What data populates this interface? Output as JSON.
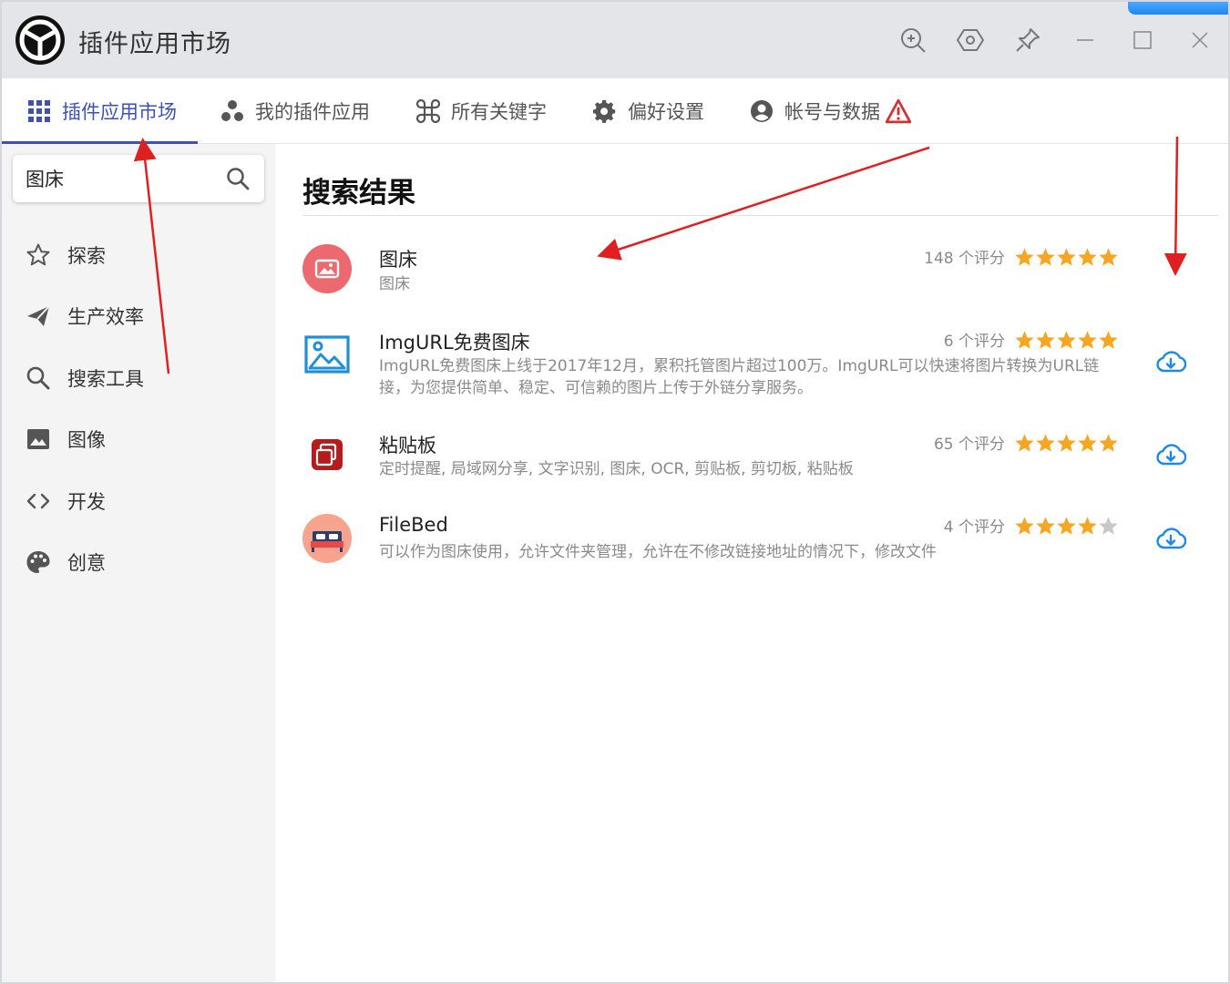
{
  "app": {
    "title": "插件应用市场"
  },
  "tabs": [
    {
      "label": "插件应用市场",
      "icon": "grid-icon"
    },
    {
      "label": "我的插件应用",
      "icon": "bubbles-icon"
    },
    {
      "label": "所有关键字",
      "icon": "command-icon"
    },
    {
      "label": "偏好设置",
      "icon": "gear-icon"
    },
    {
      "label": "帐号与数据",
      "icon": "account-icon"
    }
  ],
  "search": {
    "value": "图床"
  },
  "sidebar": {
    "items": [
      {
        "label": "探索",
        "icon": "star-outline-icon"
      },
      {
        "label": "生产效率",
        "icon": "send-icon"
      },
      {
        "label": "搜索工具",
        "icon": "search-icon"
      },
      {
        "label": "图像",
        "icon": "image-icon"
      },
      {
        "label": "开发",
        "icon": "code-icon"
      },
      {
        "label": "创意",
        "icon": "palette-icon"
      }
    ]
  },
  "main": {
    "title": "搜索结果",
    "results": [
      {
        "name": "图床",
        "desc": "图床",
        "rating_text": "148 个评分",
        "stars": 5,
        "installed": true
      },
      {
        "name": "ImgURL免费图床",
        "desc": "ImgURL免费图床上线于2017年12月，累积托管图片超过100万。ImgURL可以快速将图片转换为URL链接，为您提供简单、稳定、可信赖的图片上传于外链分享服务。",
        "rating_text": "6 个评分",
        "stars": 5,
        "installed": false
      },
      {
        "name": "粘贴板",
        "desc": "定时提醒, 局域网分享, 文字识别, 图床, OCR, 剪贴板, 剪切板, 粘贴板",
        "rating_text": "65 个评分",
        "stars": 5,
        "installed": false
      },
      {
        "name": "FileBed",
        "desc": "可以作为图床使用，允许文件夹管理，允许在不修改链接地址的情况下，修改文件",
        "rating_text": "4 个评分",
        "stars": 4,
        "installed": false
      }
    ]
  },
  "colors": {
    "accent": "#3f51b5",
    "star": "#f5a623",
    "star_empty": "#c8c8c8",
    "download": "#1e88e5",
    "arrow": "#e02020"
  }
}
